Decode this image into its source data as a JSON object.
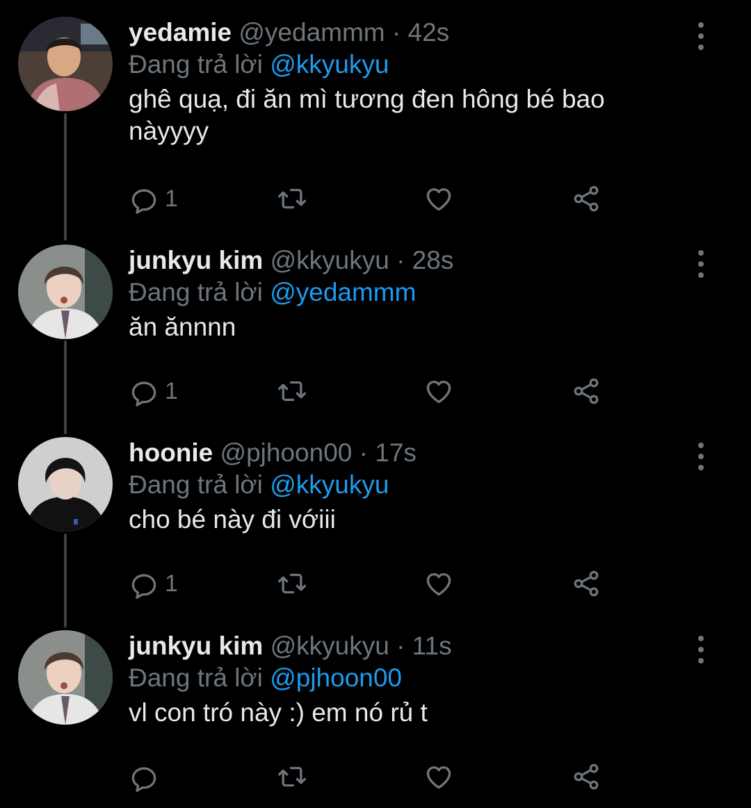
{
  "colors": {
    "background": "#000000",
    "text": "#e7e9ea",
    "muted": "#6e767d",
    "link": "#1d9bf0"
  },
  "tweets": [
    {
      "name": "yedamie",
      "handle": "@yedammm",
      "time": "· 42s",
      "reply_prefix": "Đang trả lời",
      "reply_to": "@kkyukyu",
      "text": "ghê quạ, đi ăn mì tương đen hông bé bao nàyyyy",
      "reply_count": "1",
      "icons": [
        "reply-icon",
        "retweet-icon",
        "like-icon",
        "share-icon",
        "more-icon"
      ]
    },
    {
      "name": "junkyu kim",
      "handle": "@kkyukyu",
      "time": "· 28s",
      "reply_prefix": "Đang trả lời",
      "reply_to": "@yedammm",
      "text": "ăn ănnnn",
      "reply_count": "1",
      "icons": [
        "reply-icon",
        "retweet-icon",
        "like-icon",
        "share-icon",
        "more-icon"
      ]
    },
    {
      "name": "hoonie",
      "handle": "@pjhoon00",
      "time": "· 17s",
      "reply_prefix": "Đang trả lời",
      "reply_to": "@kkyukyu",
      "text": "cho bé này đi vớiii",
      "reply_count": "1",
      "icons": [
        "reply-icon",
        "retweet-icon",
        "like-icon",
        "share-icon",
        "more-icon"
      ]
    },
    {
      "name": "junkyu kim",
      "handle": "@kkyukyu",
      "time": "· 11s",
      "reply_prefix": "Đang trả lời",
      "reply_to": "@pjhoon00",
      "text": "vl con tró này :) em nó rủ t",
      "reply_count": "",
      "icons": [
        "reply-icon",
        "retweet-icon",
        "like-icon",
        "share-icon",
        "more-icon"
      ]
    }
  ]
}
